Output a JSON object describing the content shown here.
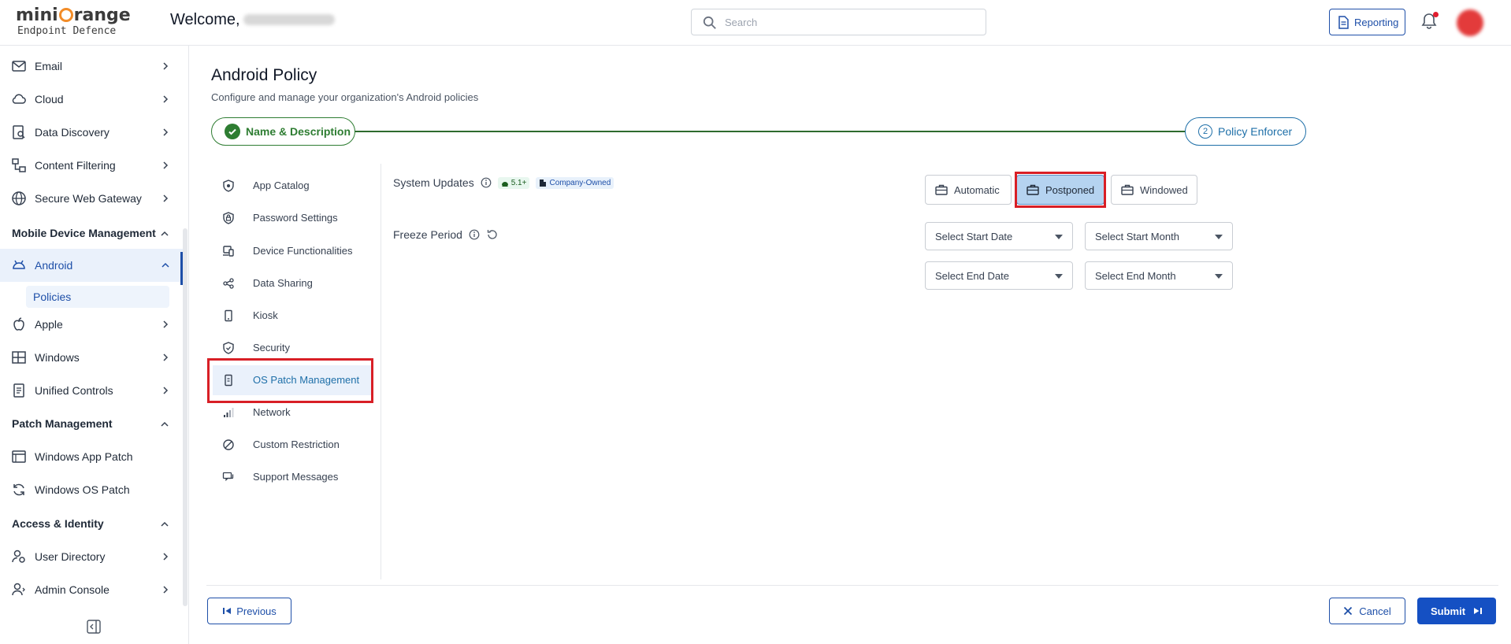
{
  "header": {
    "logo_brand": "miniOrange",
    "logo_sub": "Endpoint Defence",
    "welcome": "Welcome,",
    "search_placeholder": "Search",
    "reporting_label": "Reporting"
  },
  "sidebar": {
    "items": [
      {
        "label": "Email",
        "icon": "mail-icon"
      },
      {
        "label": "Cloud",
        "icon": "cloud-icon"
      },
      {
        "label": "Data Discovery",
        "icon": "data-discovery-icon"
      },
      {
        "label": "Content Filtering",
        "icon": "content-filter-icon"
      },
      {
        "label": "Secure Web Gateway",
        "icon": "globe-icon"
      }
    ],
    "mdm_section": "Mobile Device Management",
    "android": "Android",
    "policies": "Policies",
    "mdm_items": [
      {
        "label": "Apple",
        "icon": "apple-icon"
      },
      {
        "label": "Windows",
        "icon": "windows-icon"
      },
      {
        "label": "Unified Controls",
        "icon": "unified-controls-icon"
      }
    ],
    "patch_section": "Patch Management",
    "patch_items": [
      {
        "label": "Windows App Patch",
        "icon": "app-window-icon"
      },
      {
        "label": "Windows OS Patch",
        "icon": "refresh-icon"
      }
    ],
    "access_section": "Access & Identity",
    "access_items": [
      {
        "label": "User Directory",
        "icon": "user-directory-icon"
      },
      {
        "label": "Admin Console",
        "icon": "admin-console-icon"
      }
    ]
  },
  "main": {
    "title": "Android Policy",
    "subtitle": "Configure and manage your organization's Android policies",
    "step1": "Name & Description",
    "step2_num": "2",
    "step2": "Policy Enforcer"
  },
  "policy_nav": [
    {
      "label": "App Catalog",
      "icon": "shield-icon"
    },
    {
      "label": "Password Settings",
      "icon": "password-icon"
    },
    {
      "label": "Device Functionalities",
      "icon": "devices-icon"
    },
    {
      "label": "Data Sharing",
      "icon": "share-icon"
    },
    {
      "label": "Kiosk",
      "icon": "kiosk-icon"
    },
    {
      "label": "Security",
      "icon": "security-shield-icon"
    },
    {
      "label": "OS Patch Management",
      "icon": "phone-patch-icon"
    },
    {
      "label": "Network",
      "icon": "signal-icon"
    },
    {
      "label": "Custom Restriction",
      "icon": "block-icon"
    },
    {
      "label": "Support Messages",
      "icon": "message-icon"
    }
  ],
  "settings": {
    "system_updates_label": "System Updates",
    "version_badge": "5.1+",
    "ownership_badge": "Company-Owned",
    "update_options": [
      "Automatic",
      "Postponed",
      "Windowed"
    ],
    "selected_option": "Postponed",
    "freeze_period_label": "Freeze Period",
    "start_date": "Select Start Date",
    "start_month": "Select Start Month",
    "end_date": "Select End Date",
    "end_month": "Select End Month"
  },
  "footer": {
    "previous": "Previous",
    "cancel": "Cancel",
    "submit": "Submit"
  },
  "colors": {
    "accent": "#1e4fa8",
    "success": "#2e7d32",
    "highlight": "#d81f26",
    "selected_bg": "#b5d3f0"
  }
}
